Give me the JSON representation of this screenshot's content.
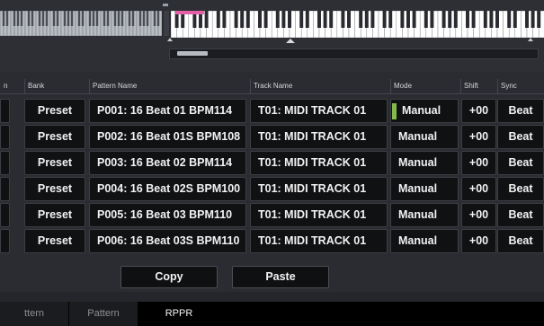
{
  "keyboard": {
    "range_marker_color": "#e45fa5",
    "mode_indicator_color": "#84b84c"
  },
  "table": {
    "headers": {
      "index": "n",
      "bank": "Bank",
      "pattern_name": "Pattern Name",
      "track_name": "Track Name",
      "mode": "Mode",
      "shift": "Shift",
      "sync": "Sync"
    },
    "rows": [
      {
        "bank": "Preset",
        "pattern": "P001: 16 Beat 01 BPM114",
        "track": "T01: MIDI TRACK 01",
        "mode": "Manual",
        "shift": "+00",
        "sync": "Beat"
      },
      {
        "bank": "Preset",
        "pattern": "P002: 16 Beat 01S BPM108",
        "track": "T01: MIDI TRACK 01",
        "mode": "Manual",
        "shift": "+00",
        "sync": "Beat"
      },
      {
        "bank": "Preset",
        "pattern": "P003: 16 Beat 02 BPM114",
        "track": "T01: MIDI TRACK 01",
        "mode": "Manual",
        "shift": "+00",
        "sync": "Beat"
      },
      {
        "bank": "Preset",
        "pattern": "P004: 16 Beat 02S BPM100",
        "track": "T01: MIDI TRACK 01",
        "mode": "Manual",
        "shift": "+00",
        "sync": "Beat"
      },
      {
        "bank": "Preset",
        "pattern": "P005: 16 Beat 03 BPM110",
        "track": "T01: MIDI TRACK 01",
        "mode": "Manual",
        "shift": "+00",
        "sync": "Beat"
      },
      {
        "bank": "Preset",
        "pattern": "P006: 16 Beat 03S BPM110",
        "track": "T01: MIDI TRACK 01",
        "mode": "Manual",
        "shift": "+00",
        "sync": "Beat"
      }
    ]
  },
  "buttons": {
    "copy": "Copy",
    "paste": "Paste"
  },
  "tabs": [
    {
      "label": "ttern",
      "active": false
    },
    {
      "label": "Pattern",
      "active": false
    },
    {
      "label": "RPPR",
      "active": true
    }
  ]
}
